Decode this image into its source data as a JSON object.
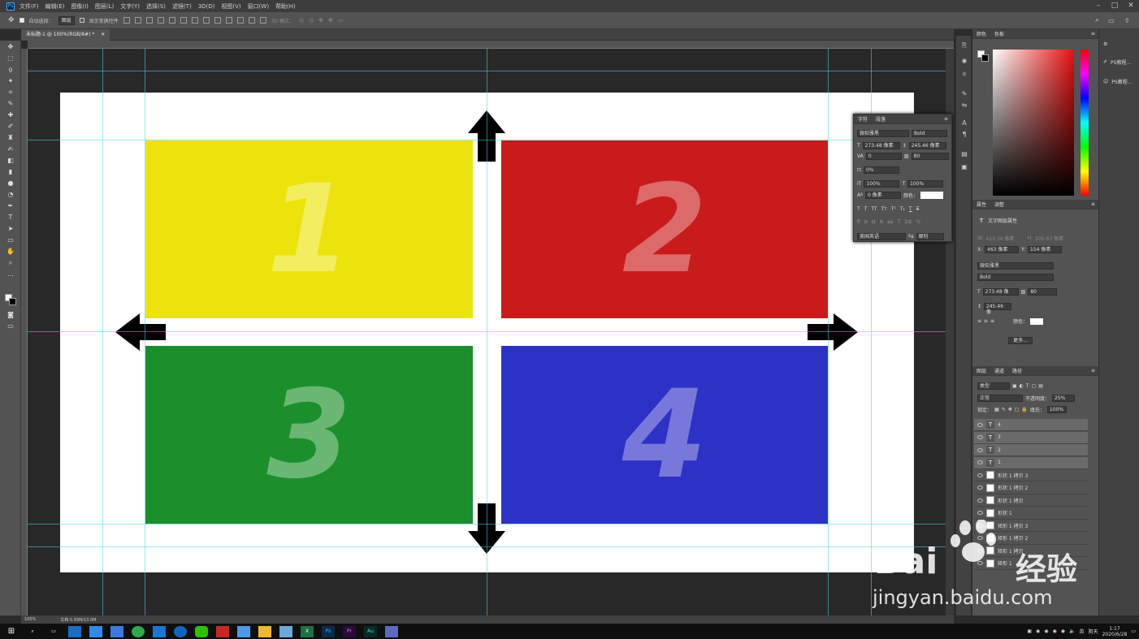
{
  "menu": {
    "logo": "Ps",
    "items": [
      "文件(F)",
      "编辑(E)",
      "图像(I)",
      "图层(L)",
      "文字(Y)",
      "选择(S)",
      "滤镜(T)",
      "3D(D)",
      "视图(V)",
      "窗口(W)",
      "帮助(H)"
    ]
  },
  "options": {
    "auto_select_label": "自动选择：",
    "auto_select_value": "图层",
    "show_transform_label": "显示变换控件",
    "mode_3d": "3D 模式："
  },
  "document": {
    "tab_title": "未标题-1 @ 100%(RGB/8#) *",
    "status_zoom": "100%",
    "status_doc": "文档:5.93M/13.0M"
  },
  "quadrants": [
    {
      "label": "1",
      "color": "#ede30c"
    },
    {
      "label": "2",
      "color": "#c91b1b"
    },
    {
      "label": "3",
      "color": "#1b8f2b"
    },
    {
      "label": "4",
      "color": "#2e31c6"
    }
  ],
  "character_panel": {
    "tabs": [
      "字符",
      "段落"
    ],
    "font_family": "微软雅黑",
    "font_style": "Bold",
    "size": "273.48 像素",
    "leading": "245.46 像素",
    "kerning": "0",
    "tracking": "80",
    "scale_pct": "0%",
    "vscale": "100%",
    "hscale": "100%",
    "baseline": "0 像素",
    "color_label": "颜色：",
    "language": "美国英语",
    "antialias": "犀利"
  },
  "color_panel": {
    "tabs": [
      "颜色",
      "色板"
    ]
  },
  "properties_panel": {
    "tabs": [
      "属性",
      "调整"
    ],
    "layer_kind": "文字图层属性",
    "w_label": "W:",
    "w_value": "410.34 像素",
    "h_label": "H:",
    "h_value": "205.67 像素",
    "x_label": "X:",
    "x_value": "463 像素",
    "y_label": "Y:",
    "y_value": "154 像素",
    "font_family": "微软雅黑",
    "font_style": "Bold",
    "size": "273.48 像",
    "tracking": "80",
    "leading": "245.46 像",
    "color_label": "颜色：",
    "more_button": "更多..."
  },
  "layers_panel": {
    "tabs": [
      "图层",
      "通道",
      "路径"
    ],
    "filter_kind": "类型",
    "blend_mode": "正常",
    "opacity_label": "不透明度：",
    "opacity_value": "25%",
    "lock_label": "锁定：",
    "fill_label": "填充：",
    "fill_value": "100%",
    "layers": [
      {
        "name": "4",
        "kind": "text",
        "selected": true
      },
      {
        "name": "3",
        "kind": "text",
        "selected": true
      },
      {
        "name": "2",
        "kind": "text",
        "selected": true
      },
      {
        "name": "1",
        "kind": "text",
        "selected": true
      },
      {
        "name": "形状 1 拷贝 3",
        "kind": "shape",
        "selected": false
      },
      {
        "name": "形状 1 拷贝 2",
        "kind": "shape",
        "selected": false
      },
      {
        "name": "形状 1 拷贝",
        "kind": "shape",
        "selected": false
      },
      {
        "name": "形状 1",
        "kind": "shape",
        "selected": false
      },
      {
        "name": "矩形 1 拷贝 3",
        "kind": "shape",
        "selected": false
      },
      {
        "name": "矩形 1 拷贝 2",
        "kind": "shape",
        "selected": false
      },
      {
        "name": "矩形 1 拷贝",
        "kind": "shape",
        "selected": false
      },
      {
        "name": "矩形 1",
        "kind": "shape",
        "selected": false
      }
    ]
  },
  "far_right": {
    "items": [
      "",
      "PS教程...",
      "PS教程..."
    ]
  },
  "taskbar": {
    "clock_time": "1:17",
    "clock_date": "2020/6/28",
    "ime": "英",
    "weather": "阴天"
  },
  "watermark": {
    "brand": "Bai",
    "brand_cn": "经验",
    "url": "jingyan.baidu.com"
  }
}
